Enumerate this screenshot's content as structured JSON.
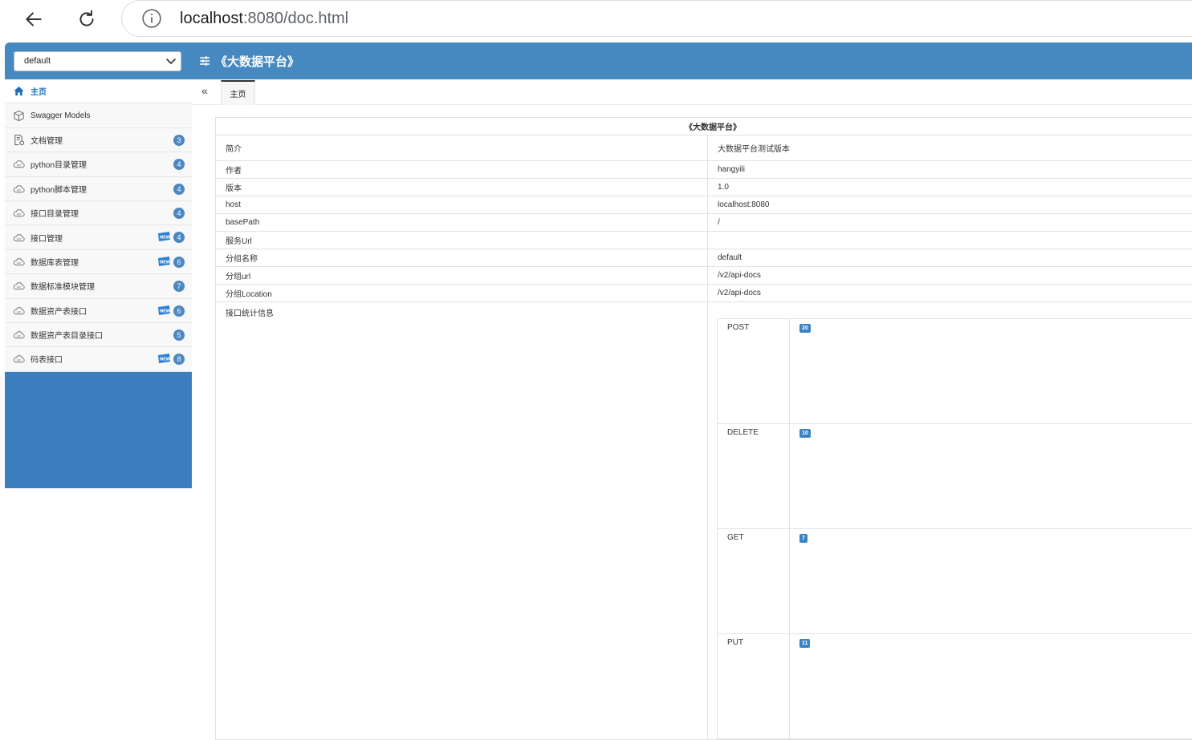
{
  "browser": {
    "url_host": "localhost",
    "url_rest": ":8080/doc.html"
  },
  "sidebar": {
    "group_select": "default",
    "items": [
      {
        "label": "主页",
        "icon": "home-icon",
        "badge": "",
        "new": false,
        "active": true
      },
      {
        "label": "Swagger Models",
        "icon": "cube-icon",
        "badge": "",
        "new": false,
        "active": false
      },
      {
        "label": "文档管理",
        "icon": "document-settings-icon",
        "badge": "3",
        "new": false,
        "active": false
      },
      {
        "label": "python目录管理",
        "icon": "cloud-icon",
        "badge": "4",
        "new": false,
        "active": false
      },
      {
        "label": "python脚本管理",
        "icon": "cloud-icon",
        "badge": "4",
        "new": false,
        "active": false
      },
      {
        "label": "接口目录管理",
        "icon": "cloud-icon",
        "badge": "4",
        "new": false,
        "active": false
      },
      {
        "label": "接口管理",
        "icon": "cloud-icon",
        "badge": "4",
        "new": true,
        "active": false
      },
      {
        "label": "数据库表管理",
        "icon": "cloud-icon",
        "badge": "6",
        "new": true,
        "active": false
      },
      {
        "label": "数据标准模块管理",
        "icon": "cloud-icon",
        "badge": "7",
        "new": false,
        "active": false
      },
      {
        "label": "数据资产表接口",
        "icon": "cloud-icon",
        "badge": "6",
        "new": true,
        "active": false
      },
      {
        "label": "数据资产表目录接口",
        "icon": "cloud-icon",
        "badge": "5",
        "new": false,
        "active": false
      },
      {
        "label": "码表接口",
        "icon": "cloud-icon",
        "badge": "8",
        "new": true,
        "active": false
      }
    ]
  },
  "topbar": {
    "title": "《大数据平台》"
  },
  "tabs": [
    {
      "label": "主页"
    }
  ],
  "info": {
    "heading": "《大数据平台》",
    "rows": [
      {
        "key": "简介",
        "value": "大数据平台测试版本"
      },
      {
        "key": "作者",
        "value": "hangyili"
      },
      {
        "key": "版本",
        "value": "1.0"
      },
      {
        "key": "host",
        "value": "localhost:8080"
      },
      {
        "key": "basePath",
        "value": "/"
      },
      {
        "key": "服务Url",
        "value": ""
      },
      {
        "key": "分组名称",
        "value": "default"
      },
      {
        "key": "分组url",
        "value": "/v2/api-docs"
      },
      {
        "key": "分组Location",
        "value": "/v2/api-docs"
      }
    ],
    "stats_label": "接口统计信息",
    "stats": [
      {
        "method": "POST",
        "count": "20"
      },
      {
        "method": "DELETE",
        "count": "10"
      },
      {
        "method": "GET",
        "count": "7"
      },
      {
        "method": "PUT",
        "count": "11"
      }
    ]
  },
  "colors": {
    "header_blue": "#4589c0",
    "sidebar_blue": "#3c7fbf",
    "badge_blue": "#4e86c0"
  }
}
